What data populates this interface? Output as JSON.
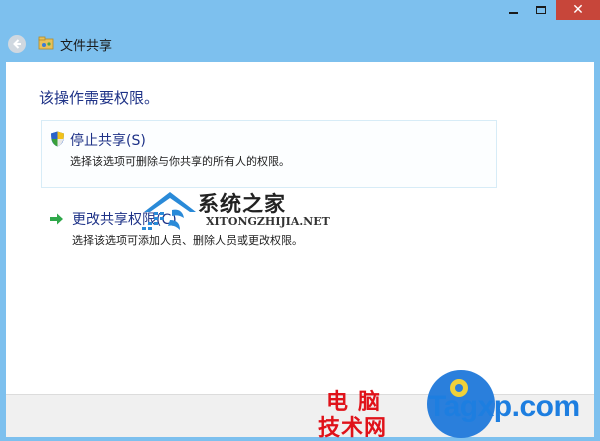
{
  "window": {
    "close_glyph": "✕"
  },
  "nav": {
    "title": "文件共享",
    "back_icon": "back-arrow-icon",
    "folder_icon": "folder-share-icon"
  },
  "content": {
    "heading": "该操作需要权限。",
    "options": [
      {
        "label": "停止共享(S)",
        "description": "选择该选项可删除与你共享的所有人的权限。",
        "icon": "uac-shield-icon"
      },
      {
        "label": "更改共享权限(C)",
        "description": "选择该选项可添加人员、删除人员或更改权限。",
        "icon": "green-arrow-icon"
      }
    ]
  },
  "watermarks": {
    "site1_title": "系统之家",
    "site1_url": "XITONGZHIJIA.NET",
    "site2_line1": "电脑",
    "site2_line2": "技术网",
    "site2_url": "Tagxp.com"
  },
  "colors": {
    "frame": "#7dc0ee",
    "link_text": "#1e3287",
    "close_button": "#c7463a",
    "watermark_red": "#e0121a",
    "watermark_blue": "#1d7ee0"
  }
}
